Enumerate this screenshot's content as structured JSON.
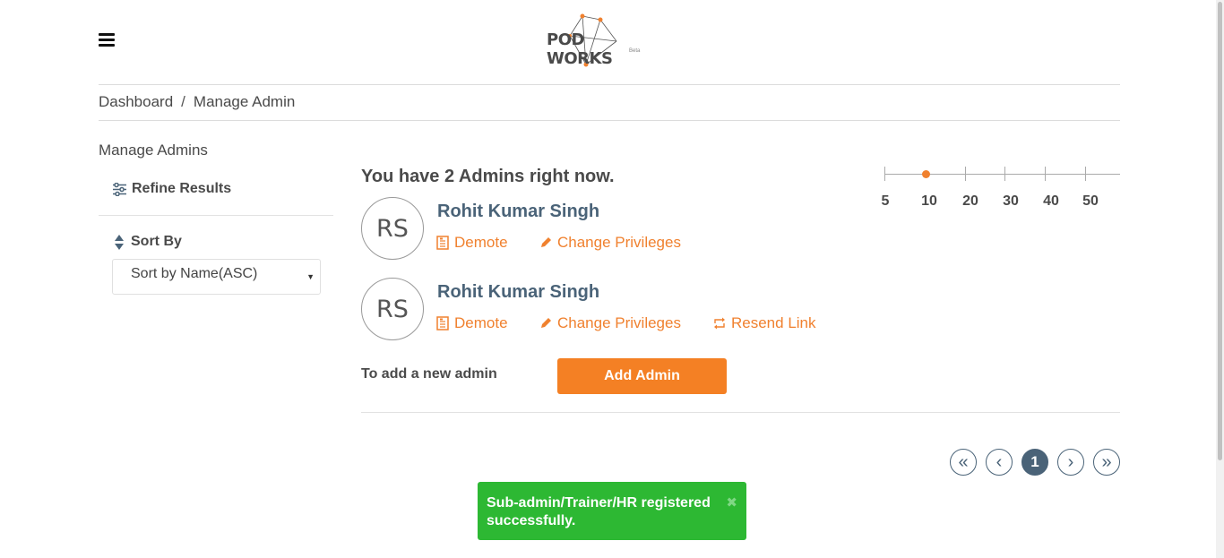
{
  "header": {
    "logo_text": "POD WORKS",
    "logo_subtext": "Beta",
    "menu_icon": "hamburger-icon"
  },
  "breadcrumb": {
    "items": [
      "Dashboard",
      "Manage Admin"
    ],
    "separator": "/"
  },
  "sidebar": {
    "title": "Manage Admins",
    "refine_label": "Refine Results",
    "refine_icon": "sliders-icon",
    "sort_label": "Sort By",
    "sort_icon": "sort-icon",
    "sort_value": "Sort by Name(ASC)"
  },
  "main": {
    "count_text": "You have 2 Admins right now.",
    "admins": [
      {
        "initials": "RS",
        "name": "Rohit Kumar Singh",
        "actions": [
          "Demote",
          "Change Privileges"
        ]
      },
      {
        "initials": "RS",
        "name": "Rohit Kumar Singh",
        "actions": [
          "Demote",
          "Change Privileges",
          "Resend Link"
        ]
      }
    ],
    "add_label": "To add a new admin",
    "add_button": "Add Admin"
  },
  "page_size": {
    "options": [
      "5",
      "10",
      "20",
      "30",
      "40",
      "50"
    ],
    "selected": "10"
  },
  "pagination": {
    "first": "«",
    "prev": "‹",
    "current": "1",
    "next": "›",
    "last": "»"
  },
  "toast": {
    "message": "Sub-admin/Trainer/HR registered successfully.",
    "close": "✖"
  },
  "colors": {
    "accent": "#f0812f",
    "button": "#f48024",
    "name": "#4a6378",
    "toast": "#2db833"
  }
}
